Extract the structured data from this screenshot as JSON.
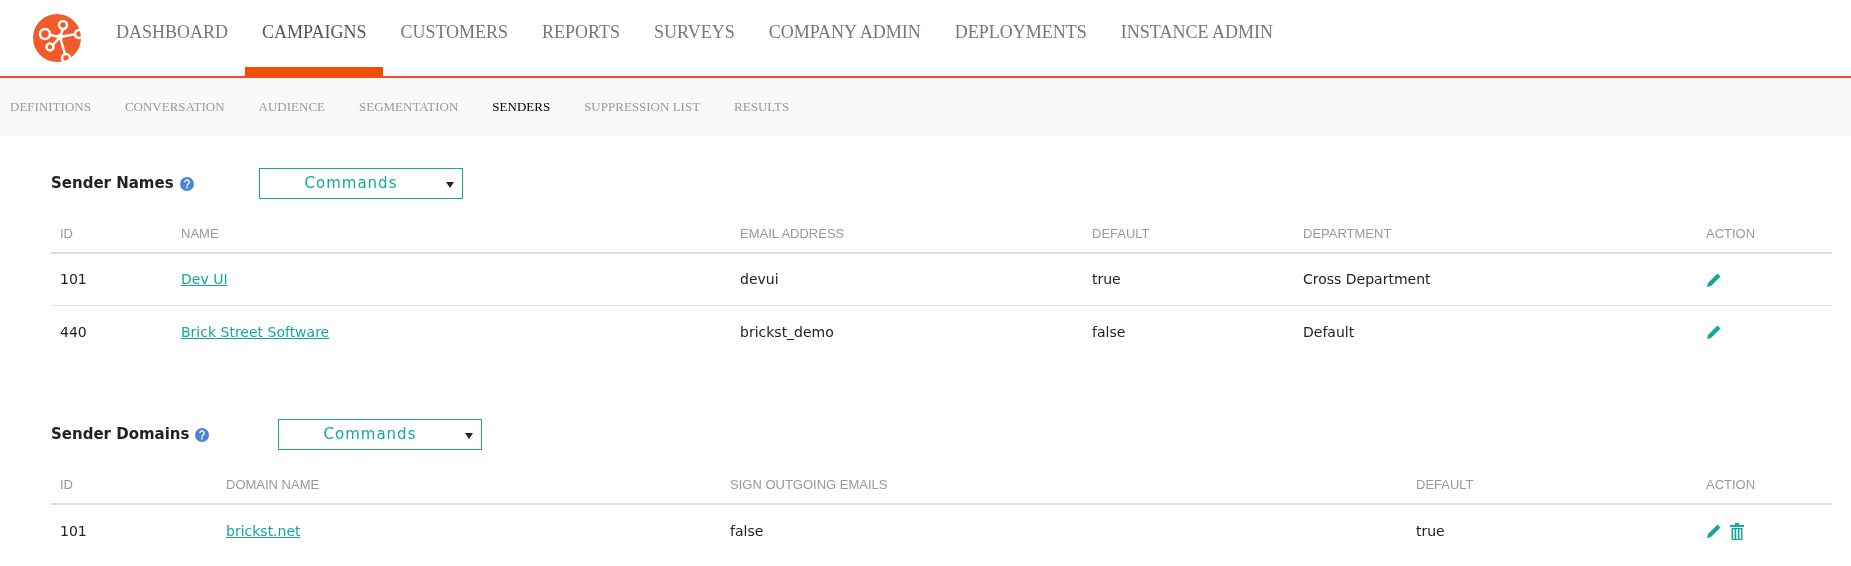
{
  "nav": [
    {
      "label": "DASHBOARD",
      "selected": false
    },
    {
      "label": "CAMPAIGNS",
      "selected": true
    },
    {
      "label": "CUSTOMERS",
      "selected": false
    },
    {
      "label": "REPORTS",
      "selected": false
    },
    {
      "label": "SURVEYS",
      "selected": false
    },
    {
      "label": "COMPANY ADMIN",
      "selected": false
    },
    {
      "label": "DEPLOYMENTS",
      "selected": false
    },
    {
      "label": "INSTANCE ADMIN",
      "selected": false
    }
  ],
  "subnav": [
    {
      "label": "DEFINITIONS",
      "selected": false
    },
    {
      "label": "CONVERSATION",
      "selected": false
    },
    {
      "label": "AUDIENCE",
      "selected": false
    },
    {
      "label": "SEGMENTATION",
      "selected": false
    },
    {
      "label": "SENDERS",
      "selected": true
    },
    {
      "label": "SUPPRESSION LIST",
      "selected": false
    },
    {
      "label": "RESULTS",
      "selected": false
    }
  ],
  "sections": [
    {
      "title": "Sender Names",
      "commands": "Commands",
      "kind": "names",
      "columns": [
        {
          "label": "ID",
          "kind": "text"
        },
        {
          "label": "NAME",
          "kind": "link"
        },
        {
          "label": "EMAIL ADDRESS",
          "kind": "text"
        },
        {
          "label": "DEFAULT",
          "kind": "text"
        },
        {
          "label": "DEPARTMENT",
          "kind": "text"
        },
        {
          "label": "ACTION",
          "kind": "actions"
        }
      ],
      "rows": [
        {
          "cells": [
            "101",
            "Dev UI",
            "devui",
            "true",
            "Cross Department"
          ],
          "deletable": false
        },
        {
          "cells": [
            "440",
            "Brick Street Software",
            "brickst_demo",
            "false",
            "Default"
          ],
          "deletable": false
        }
      ]
    },
    {
      "title": "Sender Domains",
      "commands": "Commands",
      "kind": "domains",
      "columns": [
        {
          "label": "ID",
          "kind": "text"
        },
        {
          "label": "DOMAIN NAME",
          "kind": "link"
        },
        {
          "label": "SIGN OUTGOING EMAILS",
          "kind": "text"
        },
        {
          "label": "DEFAULT",
          "kind": "text"
        },
        {
          "label": "ACTION",
          "kind": "actions"
        }
      ],
      "rows": [
        {
          "cells": [
            "101",
            "brickst.net",
            "false",
            "true"
          ],
          "deletable": true
        }
      ]
    }
  ]
}
